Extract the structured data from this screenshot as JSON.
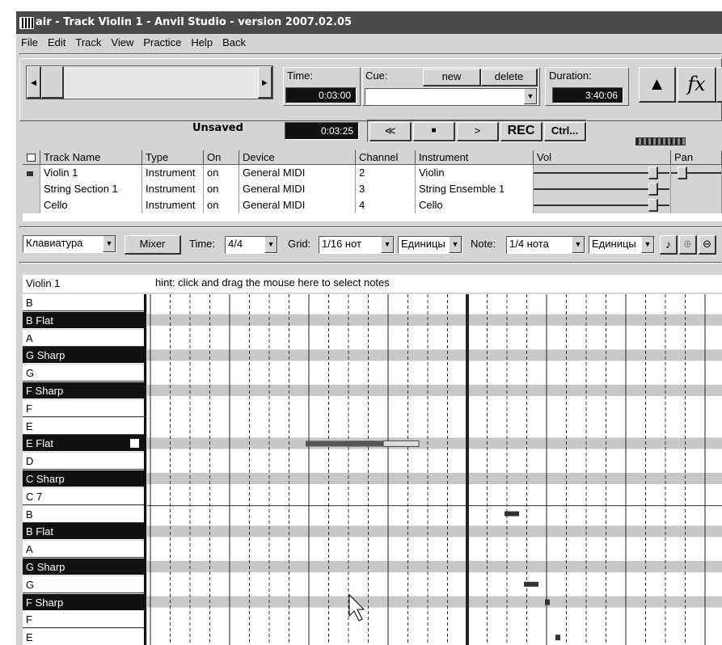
{
  "window": {
    "title": "air - Track Violin 1 - Anvil Studio - version 2007.02.05",
    "menu": [
      "File",
      "Edit",
      "Track",
      "View",
      "Practice",
      "Help",
      "Back"
    ]
  },
  "transport": {
    "time_label": "Time:",
    "time_value": "0:03:00",
    "cue_label": "Cue:",
    "cue_new": "new",
    "cue_delete": "delete",
    "duration_label": "Duration:",
    "duration_value": "3:40:06",
    "fx_label": "fx",
    "status": "Unsaved",
    "position_value": "0:03:25",
    "rewind_label": "≪",
    "stop_label": "■",
    "play_label": ">",
    "rec_label": "REC",
    "ctrl_label": "Ctrl..."
  },
  "tracks": {
    "headers": [
      "Track Name",
      "Type",
      "On",
      "Device",
      "Channel",
      "Instrument",
      "Vol",
      "Pan"
    ],
    "rows": [
      {
        "name": "Violin 1",
        "type": "Instrument",
        "on": "on",
        "device": "General MIDI",
        "channel": "2",
        "instrument": "Violin"
      },
      {
        "name": "String Section 1",
        "type": "Instrument",
        "on": "on",
        "device": "General MIDI",
        "channel": "3",
        "instrument": "String Ensemble 1"
      },
      {
        "name": "Cello",
        "type": "Instrument",
        "on": "on",
        "device": "General MIDI",
        "channel": "4",
        "instrument": "Cello"
      }
    ]
  },
  "editor_toolbar": {
    "view_select": "Клавиатура",
    "mixer_label": "Mixer",
    "time_label": "Time:",
    "time_value": "4/4",
    "grid_label": "Grid:",
    "grid_value": "1/16 нот",
    "grid_units": "Единицы",
    "note_label": "Note:",
    "note_value": "1/4 нота",
    "note_units": "Единицы"
  },
  "piano_roll": {
    "track_label": "Violin 1",
    "hint": "hint:  click and drag the mouse here to select notes",
    "keys": [
      {
        "label": "B",
        "black": false
      },
      {
        "label": "B Flat",
        "black": true
      },
      {
        "label": "A",
        "black": false
      },
      {
        "label": "G Sharp",
        "black": true
      },
      {
        "label": "G",
        "black": false
      },
      {
        "label": "F Sharp",
        "black": true
      },
      {
        "label": "F",
        "black": false
      },
      {
        "label": "E",
        "black": false
      },
      {
        "label": "E Flat",
        "black": true
      },
      {
        "label": "D",
        "black": false
      },
      {
        "label": "C Sharp",
        "black": true
      },
      {
        "label": "C 7",
        "black": false
      },
      {
        "label": "B",
        "black": false
      },
      {
        "label": "B Flat",
        "black": true
      },
      {
        "label": "A",
        "black": false
      },
      {
        "label": "G Sharp",
        "black": true
      },
      {
        "label": "G",
        "black": false
      },
      {
        "label": "F Sharp",
        "black": true
      },
      {
        "label": "F",
        "black": false
      },
      {
        "label": "E",
        "black": false
      }
    ]
  }
}
